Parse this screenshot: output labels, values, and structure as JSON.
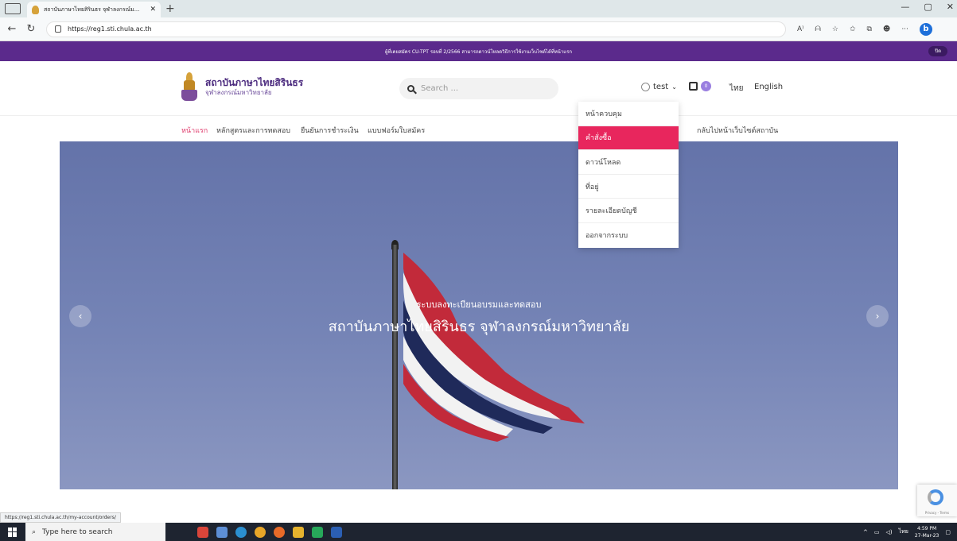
{
  "browser": {
    "tab_title": "สถาบันภาษาไทยสิรินธร จุฬาลงกรณ์ม...",
    "tab_close": "✕",
    "new_tab": "+",
    "url": "https://reg1.sti.chula.ac.th",
    "window_controls": [
      "—",
      "▢",
      "✕"
    ],
    "toolbar_icons": [
      "A⁾",
      "ᗩ",
      "☆",
      "✩",
      "⧉",
      "☻",
      "···"
    ],
    "bing_label": "b"
  },
  "announcement": {
    "text": "ผู้ที่เคยสมัคร CU-TPT รอบที่ 2/2566 สามารถดาวน์โหลดวิธีการใช้งานเว็บไซต์ได้ที่หน้าแรก",
    "close_label": "ปิด"
  },
  "header": {
    "logo_line1": "สถาบันภาษาไทยสิรินธร",
    "logo_line2": "จุฬาลงกรณ์มหาวิทยาลัย",
    "search_placeholder": "Search ...",
    "username": "test",
    "cart_count": "0",
    "lang_thai": "ไทย",
    "lang_english": "English"
  },
  "nav": {
    "home": "หน้าแรก",
    "courses": "หลักสูตรและการทดสอบ",
    "payment": "ยืนยันการชำระเงิน",
    "application": "แบบฟอร์มใบสมัคร",
    "back": "กลับไปหน้าเว็บไซต์สถาบัน"
  },
  "account_menu": {
    "items": [
      "หน้าควบคุม",
      "คำสั่งซื้อ",
      "ดาวน์โหลด",
      "ที่อยู่",
      "รายละเอียดบัญชี",
      "ออกจากระบบ"
    ],
    "active_index": 1
  },
  "hero": {
    "subtitle": "ระบบลงทะเบียนอบรมและทดสอบ",
    "title": "สถาบันภาษาไทยสิรินธร จุฬาลงกรณ์มหาวิทยาลัย",
    "prev": "‹",
    "next": "›"
  },
  "status_url": "https://reg1.sti.chula.ac.th/my-account/orders/",
  "recaptcha_terms": "Privacy - Terms",
  "taskbar": {
    "search_placeholder": "Type here to search",
    "tray_lang": "ไทย",
    "time": "4:59 PM",
    "date": "27-Mar-23"
  },
  "colors": {
    "announce_bg": "#5b2a8c",
    "accent_pink": "#e8265d",
    "brand_purple": "#4b2a7e"
  }
}
